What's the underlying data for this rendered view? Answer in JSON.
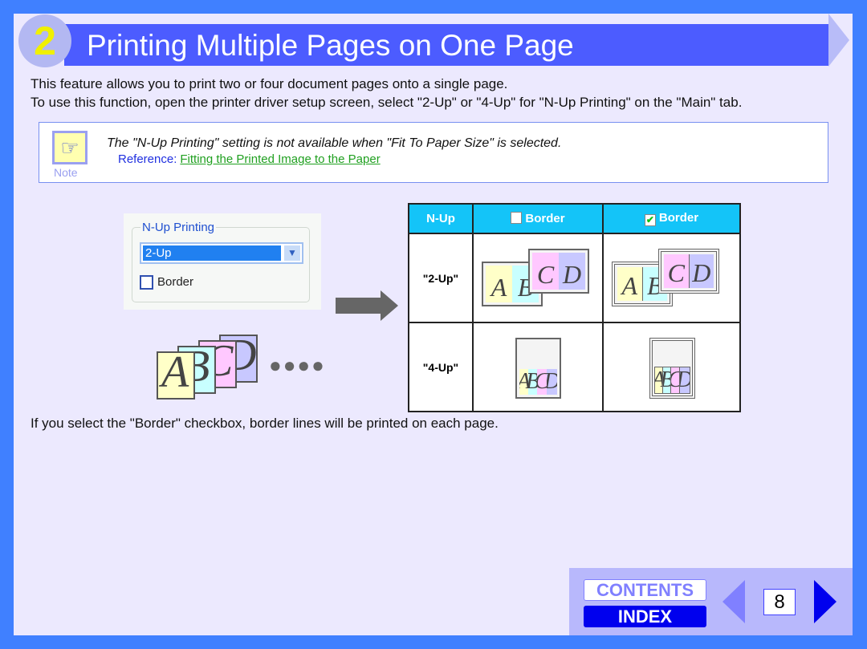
{
  "header": {
    "section_number": "2",
    "title": "Printing Multiple Pages on One Page"
  },
  "intro": [
    "This feature allows you to print two or four document pages onto a single page.",
    "To use this function, open the printer driver setup screen, select \"2-Up\" or \"4-Up\" for \"N-Up Printing\" on the \"Main\" tab."
  ],
  "note": {
    "icon": "pointing-hand-icon",
    "label": "Note",
    "text": "The \"N-Up Printing\" setting is not available when \"Fit To Paper Size\" is selected.",
    "reference_prefix": "Reference:",
    "reference_link": "Fitting the Printed Image to the Paper"
  },
  "dialog": {
    "group_label": "N-Up Printing",
    "select_value": "2-Up",
    "border_label": "Border",
    "border_checked": false
  },
  "letters": [
    "A",
    "B",
    "C",
    "D"
  ],
  "page_colors": [
    "#ffffc8",
    "#c8ffff",
    "#ffc8ff",
    "#c8c8ff"
  ],
  "table": {
    "headers": [
      "N-Up",
      "Border",
      "Border"
    ],
    "header_checked": [
      false,
      true
    ],
    "rows": [
      {
        "label": "\"2-Up\""
      },
      {
        "label": "\"4-Up\""
      }
    ]
  },
  "footer_text": "If you select the \"Border\" checkbox, border lines will be printed on each page.",
  "nav": {
    "contents": "CONTENTS",
    "index": "INDEX",
    "page": "8"
  }
}
